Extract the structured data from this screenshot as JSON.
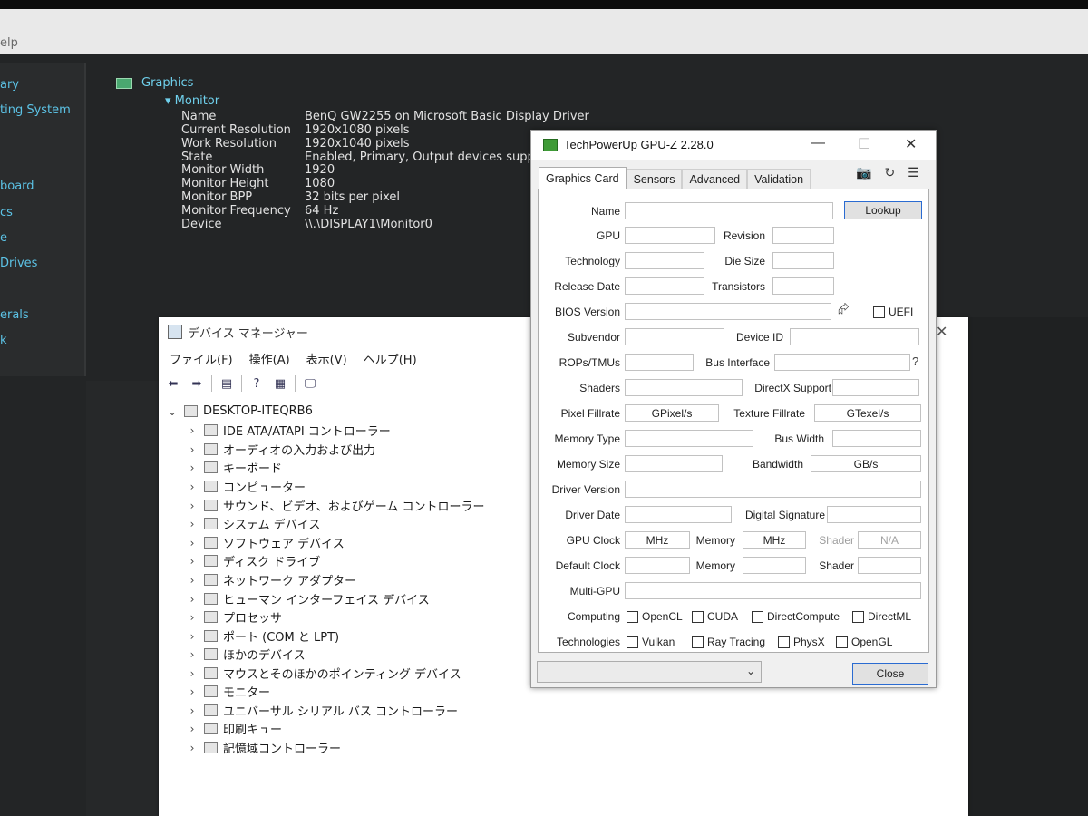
{
  "background_app": {
    "menu_fragment": "elp",
    "sidebar": [
      "ary",
      "ting System",
      "board",
      "cs",
      "e",
      " Drives",
      "erals",
      "k"
    ],
    "section_title": "Graphics",
    "subsection_title": "Monitor",
    "properties": [
      {
        "label": "Name",
        "value": "BenQ GW2255 on Microsoft Basic Display Driver"
      },
      {
        "label": "Current Resolution",
        "value": "1920x1080 pixels"
      },
      {
        "label": "Work Resolution",
        "value": "1920x1040 pixels"
      },
      {
        "label": "State",
        "value": "Enabled, Primary, Output devices supp"
      },
      {
        "label": "Monitor Width",
        "value": "1920"
      },
      {
        "label": "Monitor Height",
        "value": "1080"
      },
      {
        "label": "Monitor BPP",
        "value": "32 bits per pixel"
      },
      {
        "label": "Monitor Frequency",
        "value": "64 Hz"
      },
      {
        "label": "Device",
        "value": "\\\\.\\DISPLAY1\\Monitor0"
      }
    ]
  },
  "device_manager": {
    "title": "デバイス マネージャー",
    "close_glyph": "✕",
    "menu": [
      "ファイル(F)",
      "操作(A)",
      "表示(V)",
      "ヘルプ(H)"
    ],
    "toolbar_icons": [
      "back-arrow-icon",
      "forward-arrow-icon",
      "properties-icon",
      "help-icon",
      "view-icon",
      "monitor-icon"
    ],
    "toolbar_glyphs": [
      "⬅",
      "➡",
      "▤",
      "?",
      "▦",
      "🖵"
    ],
    "root": "DESKTOP-ITEQRB6",
    "root_chevron": "⌄",
    "child_chevron": "›",
    "items": [
      "IDE ATA/ATAPI コントローラー",
      "オーディオの入力および出力",
      "キーボード",
      "コンピューター",
      "サウンド、ビデオ、およびゲーム コントローラー",
      "システム デバイス",
      "ソフトウェア デバイス",
      "ディスク ドライブ",
      "ネットワーク アダプター",
      "ヒューマン インターフェイス デバイス",
      "プロセッサ",
      "ポート (COM と LPT)",
      "ほかのデバイス",
      "マウスとそのほかのポインティング デバイス",
      "モニター",
      "ユニバーサル シリアル バス コントローラー",
      "印刷キュー",
      "記憶域コントローラー"
    ]
  },
  "gpuz": {
    "title": "TechPowerUp GPU-Z 2.28.0",
    "win_buttons": [
      "—",
      "☐",
      "✕"
    ],
    "tabs": [
      "Graphics Card",
      "Sensors",
      "Advanced",
      "Validation"
    ],
    "tool_glyphs": [
      "📷",
      "↻",
      "☰"
    ],
    "lookup": "Lookup",
    "share_glyph": "⮳",
    "help_glyph": "?",
    "uefi": "UEFI",
    "labels": {
      "name": "Name",
      "gpu": "GPU",
      "revision": "Revision",
      "technology": "Technology",
      "die_size": "Die Size",
      "release_date": "Release Date",
      "transistors": "Transistors",
      "bios_version": "BIOS Version",
      "subvendor": "Subvendor",
      "device_id": "Device ID",
      "rops_tmus": "ROPs/TMUs",
      "bus_interface": "Bus Interface",
      "shaders": "Shaders",
      "directx_support": "DirectX Support",
      "pixel_fillrate": "Pixel Fillrate",
      "texture_fillrate": "Texture Fillrate",
      "memory_type": "Memory Type",
      "bus_width": "Bus Width",
      "memory_size": "Memory Size",
      "bandwidth": "Bandwidth",
      "driver_version": "Driver Version",
      "driver_date": "Driver Date",
      "digital_signature": "Digital Signature",
      "gpu_clock": "GPU Clock",
      "memory": "Memory",
      "shader": "Shader",
      "default_clock": "Default Clock",
      "multi_gpu": "Multi-GPU",
      "computing": "Computing",
      "technologies": "Technologies"
    },
    "values": {
      "pixel_fillrate": "GPixel/s",
      "texture_fillrate": "GTexel/s",
      "bandwidth": "GB/s",
      "gpu_clock": "MHz",
      "memory_clock": "MHz",
      "shader_clock": "N/A"
    },
    "computing": [
      "OpenCL",
      "CUDA",
      "DirectCompute",
      "DirectML"
    ],
    "technologies": [
      "Vulkan",
      "Ray Tracing",
      "PhysX",
      "OpenGL"
    ],
    "select_arrow": "⌄",
    "close": "Close"
  }
}
